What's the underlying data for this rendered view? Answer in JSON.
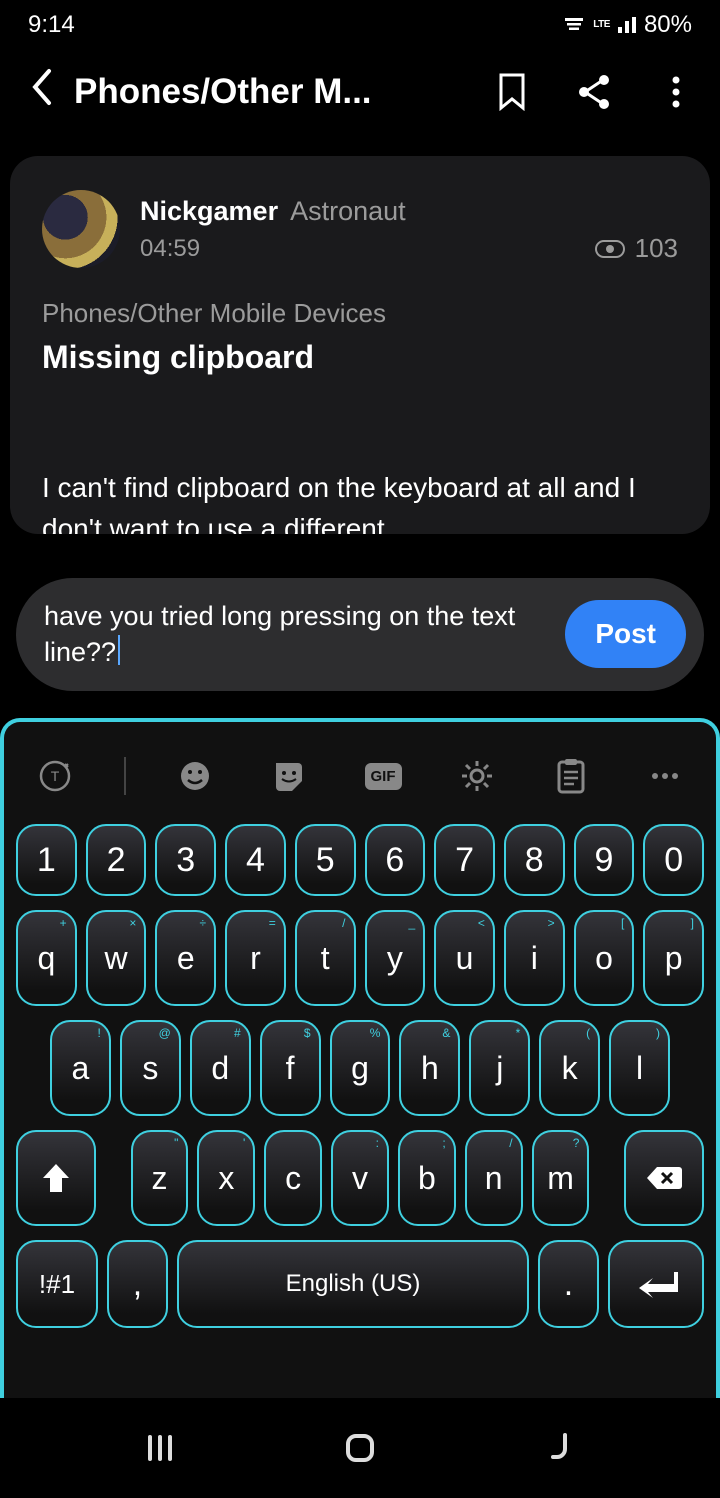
{
  "status": {
    "time": "9:14",
    "lte": "LTE",
    "battery": "80%"
  },
  "header": {
    "title": "Phones/Other M..."
  },
  "post": {
    "username": "Nickgamer",
    "rank": "Astronaut",
    "time": "04:59",
    "views": "103",
    "breadcrumb": "Phones/Other Mobile Devices",
    "title": "Missing clipboard",
    "body": "I can't find clipboard on the keyboard  at all and I don't want to use a different"
  },
  "composer": {
    "text": "have you tried long pressing on the text line??",
    "button": "Post"
  },
  "keyboard": {
    "row1": [
      "1",
      "2",
      "3",
      "4",
      "5",
      "6",
      "7",
      "8",
      "9",
      "0"
    ],
    "row2": [
      {
        "c": "q",
        "a": "+"
      },
      {
        "c": "w",
        "a": "×"
      },
      {
        "c": "e",
        "a": "÷"
      },
      {
        "c": "r",
        "a": "="
      },
      {
        "c": "t",
        "a": "/"
      },
      {
        "c": "y",
        "a": "_"
      },
      {
        "c": "u",
        "a": "<"
      },
      {
        "c": "i",
        "a": ">"
      },
      {
        "c": "o",
        "a": "["
      },
      {
        "c": "p",
        "a": "]"
      }
    ],
    "row3": [
      {
        "c": "a",
        "a": "!"
      },
      {
        "c": "s",
        "a": "@"
      },
      {
        "c": "d",
        "a": "#"
      },
      {
        "c": "f",
        "a": "$"
      },
      {
        "c": "g",
        "a": "%"
      },
      {
        "c": "h",
        "a": "&"
      },
      {
        "c": "j",
        "a": "*"
      },
      {
        "c": "k",
        "a": "("
      },
      {
        "c": "l",
        "a": ")"
      }
    ],
    "row4": [
      {
        "c": "z",
        "a": "\""
      },
      {
        "c": "x",
        "a": "'"
      },
      {
        "c": "c",
        "a": ""
      },
      {
        "c": "v",
        "a": ":"
      },
      {
        "c": "b",
        "a": ";"
      },
      {
        "c": "n",
        "a": "/"
      },
      {
        "c": "m",
        "a": "?"
      }
    ],
    "space_label": "English (US)",
    "sym_label": "!#1",
    "comma": ",",
    "dot": "."
  }
}
